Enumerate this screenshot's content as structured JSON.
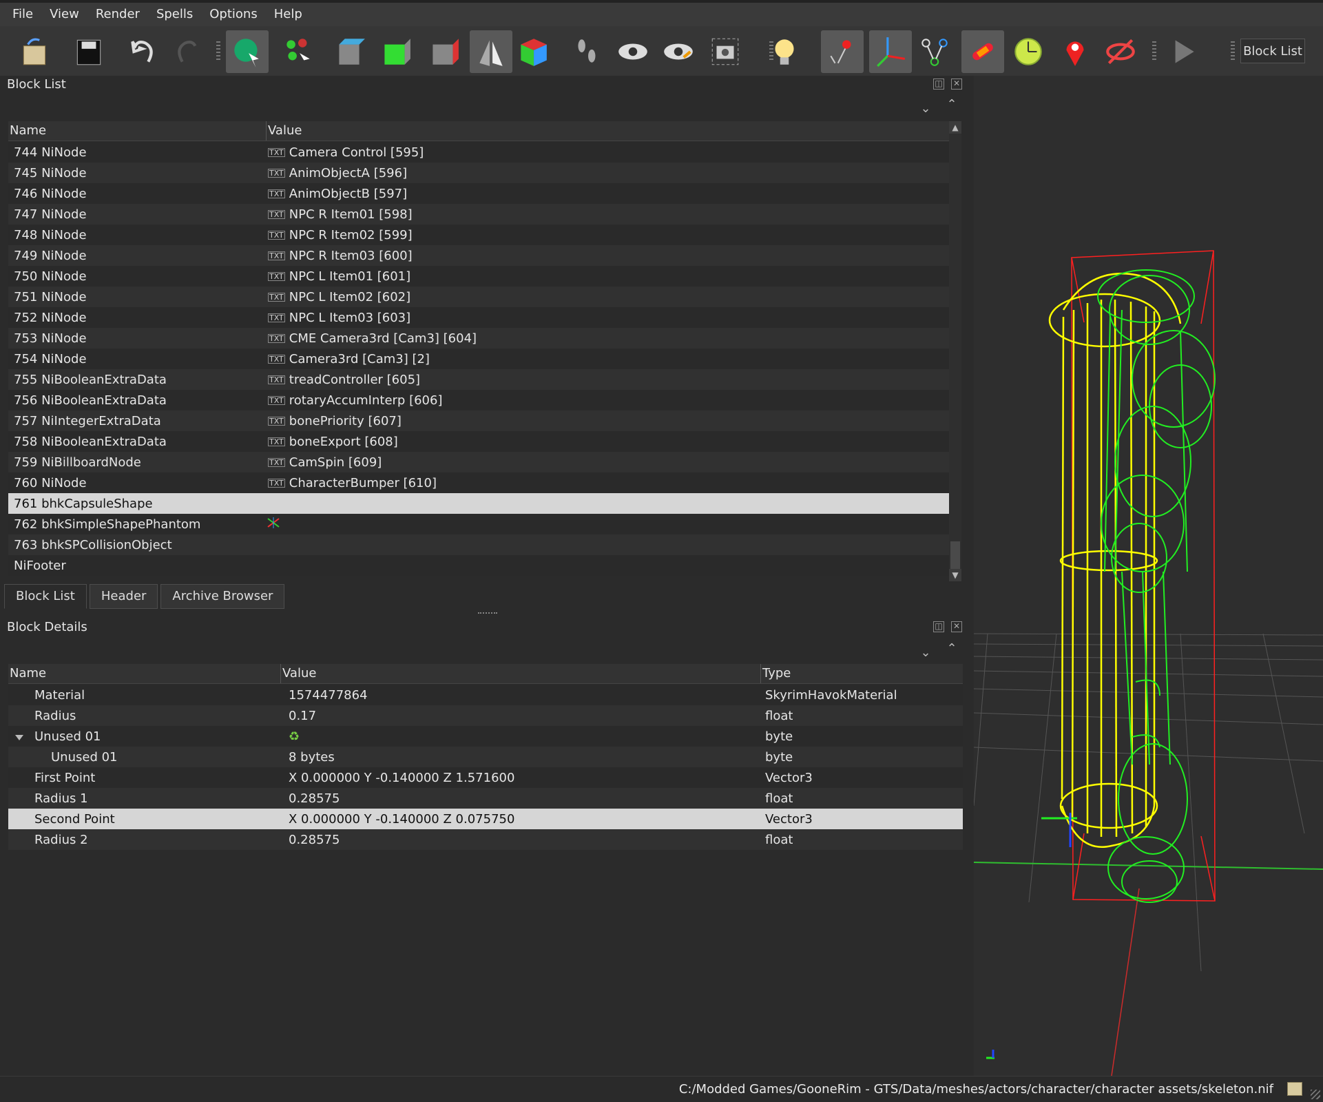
{
  "menubar": {
    "items": [
      "File",
      "View",
      "Render",
      "Spells",
      "Options",
      "Help"
    ]
  },
  "toolbar": {
    "icons": [
      "load-icon",
      "save-icon",
      "undo-icon",
      "redo-icon",
      "select-icon",
      "select-multiple-icon",
      "view-top-icon",
      "view-front-icon",
      "view-side-icon",
      "view-walk-icon",
      "view-user-icon",
      "footprints-icon",
      "eye-icon",
      "eye-edit-icon",
      "screenshot-icon",
      "light-bulb-icon",
      "marker-icon",
      "axes-icon",
      "nodes-icon",
      "havok-icon",
      "timer-icon",
      "pin-icon",
      "hide-icon",
      "play-icon"
    ],
    "blocklist_label": "Block List"
  },
  "block_list": {
    "title": "Block List",
    "columns": [
      "Name",
      "Value"
    ],
    "rows": [
      {
        "name": "744 NiNode",
        "value": "Camera Control [595]",
        "txt": true
      },
      {
        "name": "745 NiNode",
        "value": "AnimObjectA [596]",
        "txt": true
      },
      {
        "name": "746 NiNode",
        "value": "AnimObjectB [597]",
        "txt": true
      },
      {
        "name": "747 NiNode",
        "value": "NPC R Item01 [598]",
        "txt": true
      },
      {
        "name": "748 NiNode",
        "value": "NPC R Item02 [599]",
        "txt": true
      },
      {
        "name": "749 NiNode",
        "value": "NPC R Item03 [600]",
        "txt": true
      },
      {
        "name": "750 NiNode",
        "value": "NPC L Item01 [601]",
        "txt": true
      },
      {
        "name": "751 NiNode",
        "value": "NPC L Item02 [602]",
        "txt": true
      },
      {
        "name": "752 NiNode",
        "value": "NPC L Item03 [603]",
        "txt": true
      },
      {
        "name": "753 NiNode",
        "value": "CME Camera3rd [Cam3] [604]",
        "txt": true
      },
      {
        "name": "754 NiNode",
        "value": "Camera3rd [Cam3] [2]",
        "txt": true
      },
      {
        "name": "755 NiBooleanExtraData",
        "value": "treadController [605]",
        "txt": true
      },
      {
        "name": "756 NiBooleanExtraData",
        "value": "rotaryAccumInterp [606]",
        "txt": true
      },
      {
        "name": "757 NiIntegerExtraData",
        "value": "bonePriority [607]",
        "txt": true
      },
      {
        "name": "758 NiBooleanExtraData",
        "value": "boneExport [608]",
        "txt": true
      },
      {
        "name": "759 NiBillboardNode",
        "value": "CamSpin [609]",
        "txt": true
      },
      {
        "name": "760 NiNode",
        "value": "CharacterBumper [610]",
        "txt": true
      },
      {
        "name": "761 bhkCapsuleShape",
        "value": "",
        "txt": false,
        "selected": true
      },
      {
        "name": "762 bhkSimpleShapePhantom",
        "value": "",
        "txt": false,
        "axes_icon": true
      },
      {
        "name": "763 bhkSPCollisionObject",
        "value": "",
        "txt": false
      },
      {
        "name": "NiFooter",
        "value": "",
        "txt": false
      }
    ]
  },
  "tabs": [
    "Block List",
    "Header",
    "Archive Browser"
  ],
  "block_details": {
    "title": "Block Details",
    "columns": [
      "Name",
      "Value",
      "Type"
    ],
    "rows": [
      {
        "name": "Material",
        "value": "1574477864",
        "type": "SkyrimHavokMaterial",
        "indent": 1
      },
      {
        "name": "Radius",
        "value": "0.17",
        "type": "float",
        "indent": 1
      },
      {
        "name": "Unused 01",
        "value": "",
        "type": "byte",
        "indent": 1,
        "expanded": true,
        "refresh_icon": true
      },
      {
        "name": "Unused 01",
        "value": "8 bytes",
        "type": "byte",
        "indent": 2
      },
      {
        "name": "First Point",
        "value": "X 0.000000 Y -0.140000 Z 1.571600",
        "type": "Vector3",
        "indent": 1
      },
      {
        "name": "Radius 1",
        "value": "0.28575",
        "type": "float",
        "indent": 1
      },
      {
        "name": "Second Point",
        "value": "X 0.000000 Y -0.140000 Z 0.075750",
        "type": "Vector3",
        "indent": 1,
        "selected": true
      },
      {
        "name": "Radius 2",
        "value": "0.28575",
        "type": "float",
        "indent": 1
      }
    ]
  },
  "status": {
    "path": "C:/Modded Games/GooneRim - GTS/Data/meshes/actors/character/character assets/skeleton.nif"
  },
  "colors": {
    "capsule": "#ffff00",
    "skeleton": "#00ff00",
    "bounds": "#ff0000"
  }
}
